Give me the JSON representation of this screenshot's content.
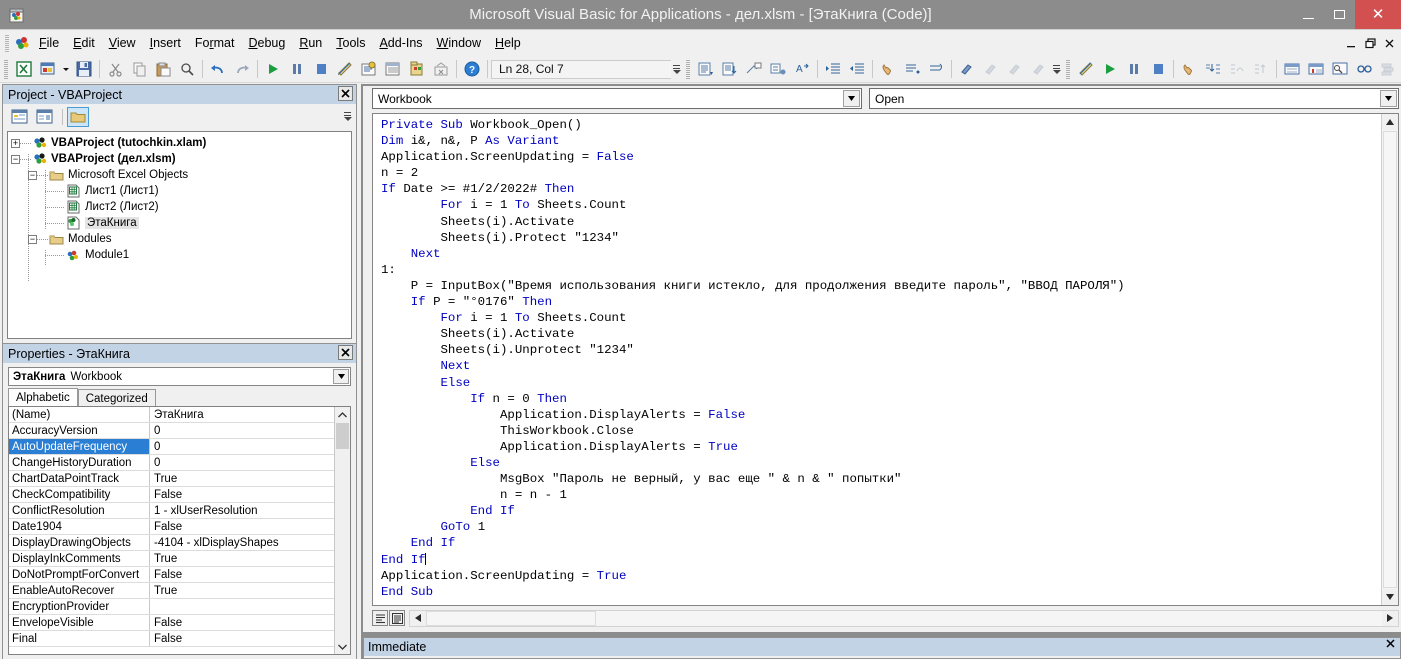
{
  "window": {
    "title": "Microsoft Visual Basic for Applications - дел.xlsm - [ЭтаКнига (Code)]",
    "app_icon": "vba-app-icon",
    "minimize": "–",
    "maximize": "□",
    "close": "✕"
  },
  "menubar": {
    "items": [
      {
        "label": "File",
        "pre": "",
        "accel": "F",
        "post": "ile"
      },
      {
        "label": "Edit",
        "pre": "",
        "accel": "E",
        "post": "dit"
      },
      {
        "label": "View",
        "pre": "",
        "accel": "V",
        "post": "iew"
      },
      {
        "label": "Insert",
        "pre": "",
        "accel": "I",
        "post": "nsert"
      },
      {
        "label": "Format",
        "pre": "Fo",
        "accel": "r",
        "post": "mat"
      },
      {
        "label": "Debug",
        "pre": "",
        "accel": "D",
        "post": "ebug"
      },
      {
        "label": "Run",
        "pre": "",
        "accel": "R",
        "post": "un"
      },
      {
        "label": "Tools",
        "pre": "",
        "accel": "T",
        "post": "ools"
      },
      {
        "label": "Add-Ins",
        "pre": "",
        "accel": "A",
        "post": "dd-Ins"
      },
      {
        "label": "Window",
        "pre": "",
        "accel": "W",
        "post": "indow"
      },
      {
        "label": "Help",
        "pre": "",
        "accel": "H",
        "post": "elp"
      }
    ],
    "mdi_restore": "❐",
    "mdi_minimize": "–",
    "mdi_close": "✕"
  },
  "toolbar": {
    "status_text": "Ln 28, Col 7",
    "buttons": [
      "view-excel-icon",
      "insert-userform-icon",
      "insert-dropdown-icon",
      "save-icon",
      "cut-icon",
      "copy-icon",
      "paste-icon",
      "find-icon",
      "undo-icon",
      "redo-icon",
      "run-icon",
      "break-icon",
      "reset-icon",
      "design-mode-icon",
      "project-explorer-icon",
      "properties-window-icon",
      "object-browser-icon",
      "toolbox-icon",
      "help-icon"
    ],
    "secondary_buttons": [
      "list-properties-icon",
      "list-constants-icon",
      "quick-info-icon",
      "parameter-info-icon",
      "complete-word-icon",
      "indent-icon",
      "outdent-icon",
      "toggle-breakpoint-icon",
      "comment-block-icon",
      "uncomment-block-icon",
      "toggle-bookmark-icon",
      "next-bookmark-icon",
      "prev-bookmark-icon",
      "clear-bookmarks-icon"
    ],
    "tertiary_buttons": [
      "design-mode-icon",
      "run-icon",
      "break-icon",
      "reset-icon",
      "toggle-breakpoint-icon",
      "step-into-icon",
      "step-over-icon",
      "step-out-icon",
      "locals-window-icon",
      "immediate-window-icon",
      "watch-window-icon",
      "quick-watch-icon",
      "call-stack-icon"
    ]
  },
  "project_explorer": {
    "title": "Project - VBAProject",
    "close_label": "✕",
    "toolbar": [
      "view-code-icon",
      "view-object-icon",
      "toggle-folders-icon"
    ],
    "tree": [
      {
        "indent": 0,
        "expander": "+",
        "icon": "project-icon",
        "label": "VBAProject (tutochkin.xlam)",
        "bold": true,
        "selected": false
      },
      {
        "indent": 0,
        "expander": "-",
        "icon": "project-icon",
        "label": "VBAProject (дел.xlsm)",
        "bold": true,
        "selected": false
      },
      {
        "indent": 1,
        "expander": "-",
        "icon": "folder-icon",
        "label": "Microsoft Excel Objects",
        "bold": false,
        "selected": false
      },
      {
        "indent": 2,
        "expander": "",
        "icon": "worksheet-icon",
        "label": "Лист1 (Лист1)",
        "bold": false,
        "selected": false
      },
      {
        "indent": 2,
        "expander": "",
        "icon": "worksheet-icon",
        "label": "Лист2 (Лист2)",
        "bold": false,
        "selected": false
      },
      {
        "indent": 2,
        "expander": "",
        "icon": "workbook-icon",
        "label": "ЭтаКнига",
        "bold": false,
        "selected": true
      },
      {
        "indent": 1,
        "expander": "-",
        "icon": "folder-icon",
        "label": "Modules",
        "bold": false,
        "selected": false
      },
      {
        "indent": 2,
        "expander": "",
        "icon": "module-icon",
        "label": "Module1",
        "bold": false,
        "selected": false
      }
    ]
  },
  "properties": {
    "title": "Properties - ЭтаКнига",
    "close_label": "✕",
    "object_name": "ЭтаКнига",
    "object_type": "Workbook",
    "dropdown_arrow": "▼",
    "tabs": [
      {
        "label": "Alphabetic",
        "active": true
      },
      {
        "label": "Categorized",
        "active": false
      }
    ],
    "rows": [
      {
        "name": "(Name)",
        "value": "ЭтаКнига",
        "selected": false
      },
      {
        "name": "AccuracyVersion",
        "value": "0",
        "selected": false
      },
      {
        "name": "AutoUpdateFrequency",
        "value": "0",
        "selected": true
      },
      {
        "name": "ChangeHistoryDuration",
        "value": "0",
        "selected": false
      },
      {
        "name": "ChartDataPointTrack",
        "value": "True",
        "selected": false
      },
      {
        "name": "CheckCompatibility",
        "value": "False",
        "selected": false
      },
      {
        "name": "ConflictResolution",
        "value": "1 - xlUserResolution",
        "selected": false
      },
      {
        "name": "Date1904",
        "value": "False",
        "selected": false
      },
      {
        "name": "DisplayDrawingObjects",
        "value": "-4104 - xlDisplayShapes",
        "selected": false
      },
      {
        "name": "DisplayInkComments",
        "value": "True",
        "selected": false
      },
      {
        "name": "DoNotPromptForConvert",
        "value": "False",
        "selected": false
      },
      {
        "name": "EnableAutoRecover",
        "value": "True",
        "selected": false
      },
      {
        "name": "EncryptionProvider",
        "value": "",
        "selected": false
      },
      {
        "name": "EnvelopeVisible",
        "value": "False",
        "selected": false
      },
      {
        "name": "Final",
        "value": "False",
        "selected": false
      }
    ],
    "scroll_up": "⌃",
    "scroll_down": "⌄"
  },
  "code_window": {
    "object_combo": "Workbook",
    "procedure_combo": "Open",
    "combo_arrow": "▼",
    "lines": [
      [
        {
          "t": "kw",
          "s": "Private Sub "
        },
        {
          "t": "pl",
          "s": "Workbook_Open()"
        }
      ],
      [
        {
          "t": "kw",
          "s": "Dim "
        },
        {
          "t": "pl",
          "s": "i&, n&, P "
        },
        {
          "t": "kw",
          "s": "As Variant"
        }
      ],
      [
        {
          "t": "pl",
          "s": "Application.ScreenUpdating = "
        },
        {
          "t": "kw",
          "s": "False"
        }
      ],
      [
        {
          "t": "pl",
          "s": "n = 2"
        }
      ],
      [
        {
          "t": "kw",
          "s": "If "
        },
        {
          "t": "pl",
          "s": "Date >= #1/2/2022# "
        },
        {
          "t": "kw",
          "s": "Then"
        }
      ],
      [
        {
          "t": "pl",
          "s": "        "
        },
        {
          "t": "kw",
          "s": "For "
        },
        {
          "t": "pl",
          "s": "i = 1 "
        },
        {
          "t": "kw",
          "s": "To "
        },
        {
          "t": "pl",
          "s": "Sheets.Count"
        }
      ],
      [
        {
          "t": "pl",
          "s": "        Sheets(i).Activate"
        }
      ],
      [
        {
          "t": "pl",
          "s": "        Sheets(i).Protect \"1234\""
        }
      ],
      [
        {
          "t": "pl",
          "s": "    "
        },
        {
          "t": "kw",
          "s": "Next"
        }
      ],
      [
        {
          "t": "pl",
          "s": "1:"
        }
      ],
      [
        {
          "t": "pl",
          "s": "    P = InputBox(\"Время использования книги истекло, для продолжения введите пароль\", \"ВВОД ПАРОЛЯ\")"
        }
      ],
      [
        {
          "t": "pl",
          "s": "    "
        },
        {
          "t": "kw",
          "s": "If "
        },
        {
          "t": "pl",
          "s": "P = \"°0176\" "
        },
        {
          "t": "kw",
          "s": "Then"
        }
      ],
      [
        {
          "t": "pl",
          "s": "        "
        },
        {
          "t": "kw",
          "s": "For "
        },
        {
          "t": "pl",
          "s": "i = 1 "
        },
        {
          "t": "kw",
          "s": "To "
        },
        {
          "t": "pl",
          "s": "Sheets.Count"
        }
      ],
      [
        {
          "t": "pl",
          "s": "        Sheets(i).Activate"
        }
      ],
      [
        {
          "t": "pl",
          "s": "        Sheets(i).Unprotect \"1234\""
        }
      ],
      [
        {
          "t": "pl",
          "s": "        "
        },
        {
          "t": "kw",
          "s": "Next"
        }
      ],
      [
        {
          "t": "pl",
          "s": "        "
        },
        {
          "t": "kw",
          "s": "Else"
        }
      ],
      [
        {
          "t": "pl",
          "s": "            "
        },
        {
          "t": "kw",
          "s": "If "
        },
        {
          "t": "pl",
          "s": "n = 0 "
        },
        {
          "t": "kw",
          "s": "Then"
        }
      ],
      [
        {
          "t": "pl",
          "s": "                Application.DisplayAlerts = "
        },
        {
          "t": "kw",
          "s": "False"
        }
      ],
      [
        {
          "t": "pl",
          "s": "                ThisWorkbook.Close"
        }
      ],
      [
        {
          "t": "pl",
          "s": "                Application.DisplayAlerts = "
        },
        {
          "t": "kw",
          "s": "True"
        }
      ],
      [
        {
          "t": "pl",
          "s": "            "
        },
        {
          "t": "kw",
          "s": "Else"
        }
      ],
      [
        {
          "t": "pl",
          "s": "                MsgBox \"Пароль не верный, у вас еще \" & n & \" попытки\""
        }
      ],
      [
        {
          "t": "pl",
          "s": "                n = n - 1"
        }
      ],
      [
        {
          "t": "pl",
          "s": "            "
        },
        {
          "t": "kw",
          "s": "End If"
        }
      ],
      [
        {
          "t": "pl",
          "s": "        "
        },
        {
          "t": "kw",
          "s": "GoTo "
        },
        {
          "t": "pl",
          "s": "1"
        }
      ],
      [
        {
          "t": "pl",
          "s": "    "
        },
        {
          "t": "kw",
          "s": "End If"
        }
      ],
      [
        {
          "t": "kw",
          "s": "End If"
        },
        {
          "t": "cursor",
          "s": ""
        }
      ],
      [
        {
          "t": "pl",
          "s": "Application.ScreenUpdating = "
        },
        {
          "t": "kw",
          "s": "True"
        }
      ],
      [
        {
          "t": "kw",
          "s": "End Sub"
        }
      ]
    ],
    "view_buttons": [
      "procedure-view-icon",
      "full-module-view-icon"
    ],
    "scroll_up": "▲",
    "scroll_down": "▼",
    "scroll_left": "◄",
    "scroll_right": "►"
  },
  "immediate_window": {
    "title": "Immediate",
    "close_label": "✕"
  },
  "colors": {
    "titlebar": "#8c8c8c",
    "close_button": "#d35050",
    "panel_caption": "#c3d3e6",
    "selection": "#2a7fd4",
    "keyword": "#0000c0",
    "code_text": "#000000",
    "window_bg": "#f0f0f0",
    "mdi_bg": "#8c8c8c"
  }
}
